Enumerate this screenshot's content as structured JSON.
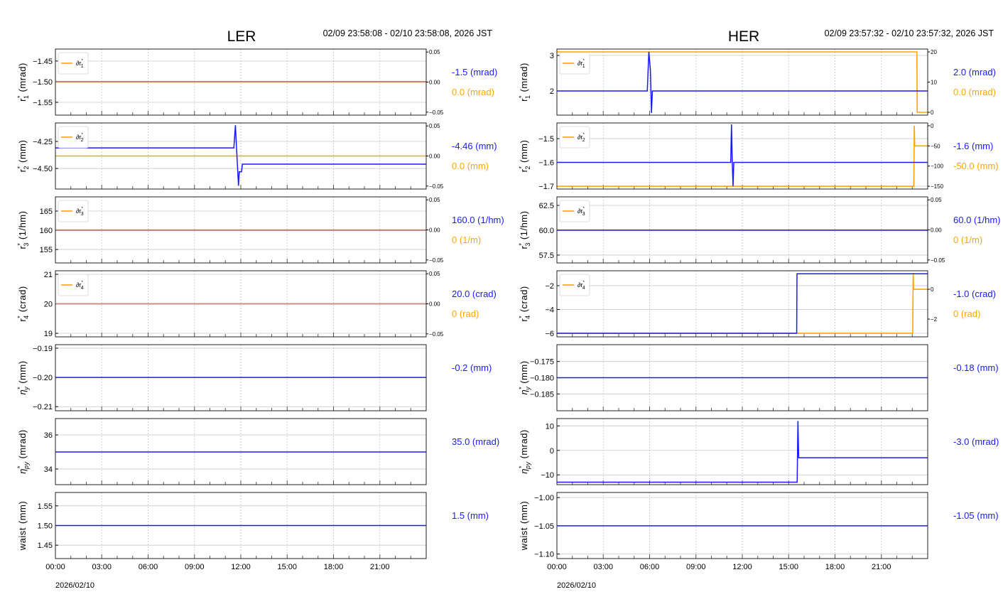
{
  "chart_data": [
    {
      "type": "line",
      "title": "LER",
      "time_range": "02/09 23:58:08 - 02/10 23:58:08, 2026 JST",
      "xlim": [
        0,
        24
      ],
      "xticks": [
        0,
        3,
        6,
        9,
        12,
        15,
        18,
        21
      ],
      "xtick_labels": [
        "00:00",
        "03:00",
        "06:00",
        "09:00",
        "12:00",
        "15:00",
        "18:00",
        "21:00"
      ],
      "date_label": "2026/02/10",
      "panels": [
        {
          "ylabel": {
            "base": "r",
            "sub": "1",
            "unit": "(mrad)"
          },
          "ylim": [
            -1.581,
            -1.421
          ],
          "yticks": [
            -1.45,
            -1.5,
            -1.55
          ],
          "ytick_labels": [
            "−1.45",
            "−1.50",
            "−1.55"
          ],
          "series": [
            [
              0,
              -1.5
            ],
            [
              24,
              -1.5
            ]
          ],
          "legend": {
            "base": "∂r",
            "sub": "1"
          },
          "ylim2": [
            -0.055,
            0.055
          ],
          "yticks2": [
            0.05,
            0,
            -0.05
          ],
          "ytick2_labels": [
            "0.05",
            "0.00",
            "−0.05"
          ],
          "series2": [
            [
              0,
              0
            ],
            [
              24,
              0
            ]
          ],
          "value": "-1.5 (mrad)",
          "value2": "0.0 (mrad)"
        },
        {
          "ylabel": {
            "base": "r",
            "sub": "2",
            "unit": "(mm)"
          },
          "ylim": [
            -4.69,
            -4.079
          ],
          "yticks": [
            -4.25,
            -4.5
          ],
          "ytick_labels": [
            "−4.25",
            "−4.50"
          ],
          "series": [
            [
              0,
              -4.31
            ],
            [
              11.55,
              -4.31
            ],
            [
              11.65,
              -4.1
            ],
            [
              11.72,
              -4.3
            ],
            [
              11.85,
              -4.66
            ],
            [
              11.9,
              -4.53
            ],
            [
              12.05,
              -4.53
            ],
            [
              12.1,
              -4.46
            ],
            [
              24,
              -4.46
            ]
          ],
          "legend": {
            "base": "∂r",
            "sub": "2"
          },
          "ylim2": [
            -0.055,
            0.055
          ],
          "yticks2": [
            0.05,
            0,
            -0.05
          ],
          "ytick2_labels": [
            "0.05",
            "0.00",
            "−0.05"
          ],
          "series2": [
            [
              0,
              0
            ],
            [
              24,
              0
            ]
          ],
          "value": "-4.46 (mm)",
          "value2": "0.0 (mm)"
        },
        {
          "ylabel": {
            "base": "r",
            "sub": "3",
            "unit": "(1/hm)"
          },
          "ylim": [
            151.5,
            168.7
          ],
          "yticks": [
            165,
            160,
            155
          ],
          "ytick_labels": [
            "165",
            "160",
            "155"
          ],
          "series": [
            [
              0,
              160
            ],
            [
              24,
              160
            ]
          ],
          "legend": {
            "base": "∂r",
            "sub": "3"
          },
          "ylim2": [
            -0.055,
            0.055
          ],
          "yticks2": [
            0.05,
            0,
            -0.05
          ],
          "ytick2_labels": [
            "0.05",
            "0.00",
            "−0.05"
          ],
          "series2": [
            [
              0,
              0
            ],
            [
              24,
              0
            ]
          ],
          "value": "160.0 (1/hm)",
          "value2": "0 (1/m)"
        },
        {
          "ylabel": {
            "base": "r",
            "sub": "4",
            "unit": "(crad)"
          },
          "ylim": [
            18.88,
            21.12
          ],
          "yticks": [
            21,
            20,
            19
          ],
          "ytick_labels": [
            "21",
            "20",
            "19"
          ],
          "series": [
            [
              0,
              20
            ],
            [
              24,
              20
            ]
          ],
          "legend": {
            "base": "∂r",
            "sub": "4"
          },
          "ylim2": [
            -0.055,
            0.055
          ],
          "yticks2": [
            0.05,
            0,
            -0.05
          ],
          "ytick2_labels": [
            "0.05",
            "0.00",
            "−0.05"
          ],
          "series2": [
            [
              0,
              0
            ],
            [
              24,
              0
            ]
          ],
          "value": "20.0 (crad)",
          "value2": "0 (rad)"
        },
        {
          "ylabel": {
            "base": "η",
            "sub": "y",
            "unit": "(mm)"
          },
          "ylim": [
            -0.2114,
            -0.1888
          ],
          "yticks": [
            -0.19,
            -0.2,
            -0.21
          ],
          "ytick_labels": [
            "−0.19",
            "−0.20",
            "−0.21"
          ],
          "series": [
            [
              0,
              -0.2
            ],
            [
              24,
              -0.2
            ]
          ],
          "value": "-0.2 (mm)"
        },
        {
          "ylabel": {
            "base": "η",
            "sub": "py",
            "unit": "(mrad)"
          },
          "ylim": [
            33.08,
            36.96
          ],
          "yticks": [
            36,
            34
          ],
          "ytick_labels": [
            "36",
            "34"
          ],
          "series": [
            [
              0,
              35
            ],
            [
              24,
              35
            ]
          ],
          "value": "35.0 (mrad)"
        },
        {
          "ylabel": {
            "base": "waist",
            "sub": "",
            "unit": "(mm)"
          },
          "ylim": [
            1.416,
            1.584
          ],
          "yticks": [
            1.55,
            1.5,
            1.45
          ],
          "ytick_labels": [
            "1.55",
            "1.50",
            "1.45"
          ],
          "series": [
            [
              0,
              1.5
            ],
            [
              24,
              1.5
            ]
          ],
          "value": "1.5 (mm)"
        }
      ]
    },
    {
      "type": "line",
      "title": "HER",
      "time_range": "02/09 23:57:32 - 02/10 23:57:32, 2026 JST",
      "xlim": [
        0,
        24
      ],
      "xticks": [
        0,
        3,
        6,
        9,
        12,
        15,
        18,
        21
      ],
      "xtick_labels": [
        "00:00",
        "03:00",
        "06:00",
        "09:00",
        "12:00",
        "15:00",
        "18:00",
        "21:00"
      ],
      "date_label": "2026/02/10",
      "panels": [
        {
          "ylabel": {
            "base": "r",
            "sub": "1",
            "unit": "(mrad)"
          },
          "ylim": [
            1.32,
            3.18
          ],
          "yticks": [
            3,
            2
          ],
          "ytick_labels": [
            "3",
            "2"
          ],
          "series": [
            [
              0,
              2
            ],
            [
              5.85,
              2
            ],
            [
              5.95,
              3.1
            ],
            [
              6.05,
              2.6
            ],
            [
              6.12,
              1.38
            ],
            [
              6.18,
              2
            ],
            [
              24,
              2
            ]
          ],
          "legend": {
            "base": "∂r",
            "sub": "1"
          },
          "ylim2": [
            -0.94,
            20.94
          ],
          "yticks2": [
            20,
            10,
            0
          ],
          "ytick2_labels": [
            "20",
            "10",
            "0"
          ],
          "series2": [
            [
              0,
              20
            ],
            [
              23.3,
              20
            ],
            [
              23.32,
              0
            ],
            [
              24,
              0
            ]
          ],
          "value": "2.0 (mrad)",
          "value2": "0.0 (mrad)"
        },
        {
          "ylabel": {
            "base": "r",
            "sub": "2",
            "unit": "(mm)"
          },
          "ylim": [
            -1.712,
            -1.434
          ],
          "yticks": [
            -1.5,
            -1.6,
            -1.7
          ],
          "ytick_labels": [
            "−1.5",
            "−1.6",
            "−1.7"
          ],
          "series": [
            [
              0,
              -1.6
            ],
            [
              11.25,
              -1.6
            ],
            [
              11.3,
              -1.44
            ],
            [
              11.35,
              -1.6
            ],
            [
              11.4,
              -1.7
            ],
            [
              11.45,
              -1.6
            ],
            [
              24,
              -1.6
            ]
          ],
          "legend": {
            "base": "∂r",
            "sub": "2"
          },
          "ylim2": [
            -157,
            7
          ],
          "yticks2": [
            0,
            -50,
            -100,
            -150
          ],
          "ytick2_labels": [
            "0",
            "−50",
            "−100",
            "−150"
          ],
          "series2": [
            [
              0,
              -150
            ],
            [
              23.1,
              -150
            ],
            [
              23.13,
              0
            ],
            [
              23.16,
              -50
            ],
            [
              24,
              -50
            ]
          ],
          "value": "-1.6 (mm)",
          "value2": "-50.0 (mm)"
        },
        {
          "ylabel": {
            "base": "r",
            "sub": "3",
            "unit": "(1/hm)"
          },
          "ylim": [
            56.71,
            63.36
          ],
          "yticks": [
            62.5,
            60,
            57.5
          ],
          "ytick_labels": [
            "62.5",
            "60.0",
            "57.5"
          ],
          "series": [
            [
              0,
              60
            ],
            [
              24,
              60
            ]
          ],
          "legend": {
            "base": "∂r",
            "sub": "3"
          },
          "ylim2": [
            -0.055,
            0.055
          ],
          "yticks2": [
            0.05,
            0,
            -0.05
          ],
          "ytick2_labels": [
            "0.05",
            "0.00",
            "−0.05"
          ],
          "series2": [
            [
              0,
              0
            ],
            [
              24,
              0
            ]
          ],
          "value": "60.0 (1/hm)",
          "value2": "0 (1/m)"
        },
        {
          "ylabel": {
            "base": "r",
            "sub": "4",
            "unit": "(crad)"
          },
          "ylim": [
            -6.3,
            -0.75
          ],
          "yticks": [
            -2,
            -4,
            -6
          ],
          "ytick_labels": [
            "−2",
            "−4",
            "−6"
          ],
          "series": [
            [
              0,
              -6
            ],
            [
              15.52,
              -6
            ],
            [
              15.54,
              -1
            ],
            [
              24,
              -1
            ]
          ],
          "legend": {
            "base": "∂r",
            "sub": "4"
          },
          "ylim2": [
            -3.19,
            1.24
          ],
          "yticks2": [
            0,
            -2
          ],
          "ytick2_labels": [
            "0",
            "−2"
          ],
          "series2": [
            [
              0,
              -2.95
            ],
            [
              23.03,
              -2.95
            ],
            [
              23.06,
              1.1
            ],
            [
              23.09,
              0
            ],
            [
              24,
              0
            ]
          ],
          "value": "-1.0 (crad)",
          "value2": "0 (rad)"
        },
        {
          "ylabel": {
            "base": "η",
            "sub": "y",
            "unit": "(mm)"
          },
          "ylim": [
            -0.1902,
            -0.1698
          ],
          "yticks": [
            -0.175,
            -0.18,
            -0.185
          ],
          "ytick_labels": [
            "−0.175",
            "−0.180",
            "−0.185"
          ],
          "series": [
            [
              0,
              -0.18
            ],
            [
              24,
              -0.18
            ]
          ],
          "value": "-0.18 (mm)"
        },
        {
          "ylabel": {
            "base": "η",
            "sub": "py",
            "unit": "(mrad)"
          },
          "ylim": [
            -14,
            13
          ],
          "yticks": [
            10,
            0,
            -10
          ],
          "ytick_labels": [
            "10",
            "0",
            "−10"
          ],
          "series": [
            [
              0,
              -13
            ],
            [
              15.55,
              -13
            ],
            [
              15.6,
              12
            ],
            [
              15.65,
              -3
            ],
            [
              24,
              -3
            ]
          ],
          "value": "-3.0 (mrad)"
        },
        {
          "ylabel": {
            "base": "waist",
            "sub": "",
            "unit": "(mm)"
          },
          "ylim": [
            -1.108,
            -0.991
          ],
          "yticks": [
            -1,
            -1.05,
            -1.1
          ],
          "ytick_labels": [
            "−1.00",
            "−1.05",
            "−1.10"
          ],
          "series": [
            [
              0,
              -1.05
            ],
            [
              24,
              -1.05
            ]
          ],
          "value": "-1.05 (mm)"
        }
      ]
    }
  ],
  "colors": {
    "primary": "#1a1aff",
    "secondary": "#ffa500"
  }
}
